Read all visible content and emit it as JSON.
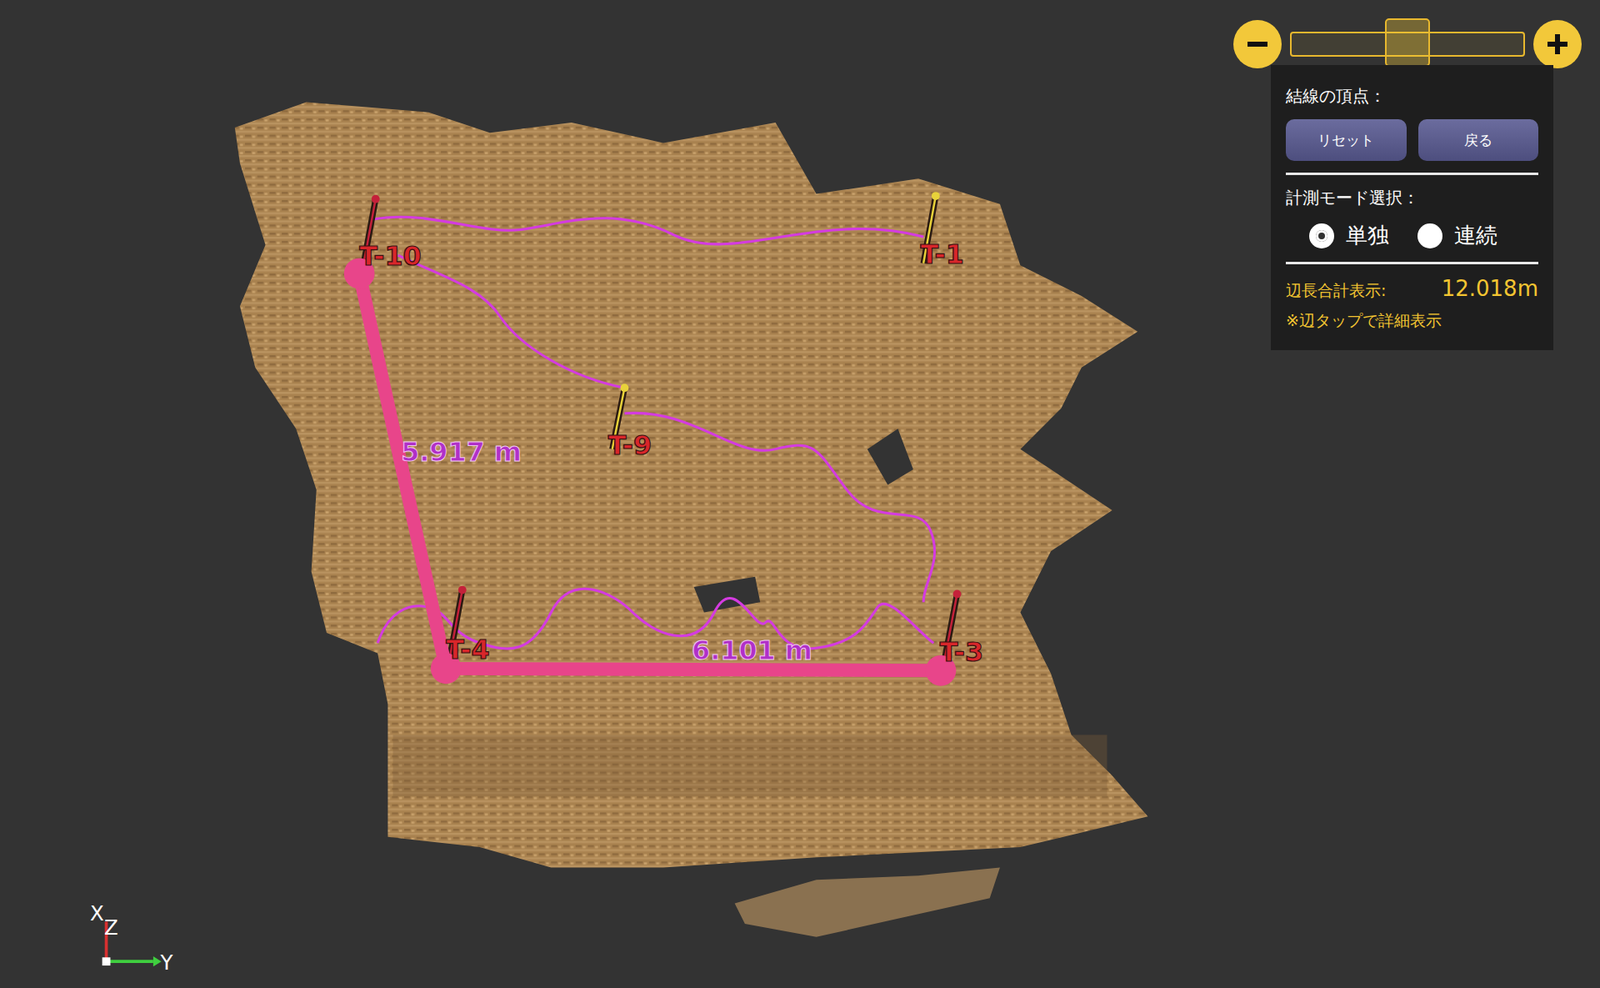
{
  "viewer": {
    "stakes": [
      {
        "label": "T-10",
        "color": "#c4213a"
      },
      {
        "label": "T-1",
        "color": "#e8d23a"
      },
      {
        "label": "T-9",
        "color": "#e8d23a"
      },
      {
        "label": "T-4",
        "color": "#c4213a"
      },
      {
        "label": "T-3",
        "color": "#c4213a"
      }
    ],
    "segments": [
      {
        "length": "5.917 m"
      },
      {
        "length": "6.101 m"
      }
    ],
    "axes": {
      "x": "X",
      "z": "Z",
      "y": "Y"
    }
  },
  "zoom": {
    "level": 0.5
  },
  "panel": {
    "vertex_title": "結線の頂点：",
    "buttons": [
      "リセット",
      "戻る"
    ],
    "mode_title": "計測モード選択：",
    "modes": [
      {
        "label": "単独",
        "selected": true
      },
      {
        "label": "連続",
        "selected": false
      }
    ],
    "total_label": "辺長合計表示:",
    "total_value": "12.018m",
    "hint": "※辺タップで詳細表示"
  }
}
